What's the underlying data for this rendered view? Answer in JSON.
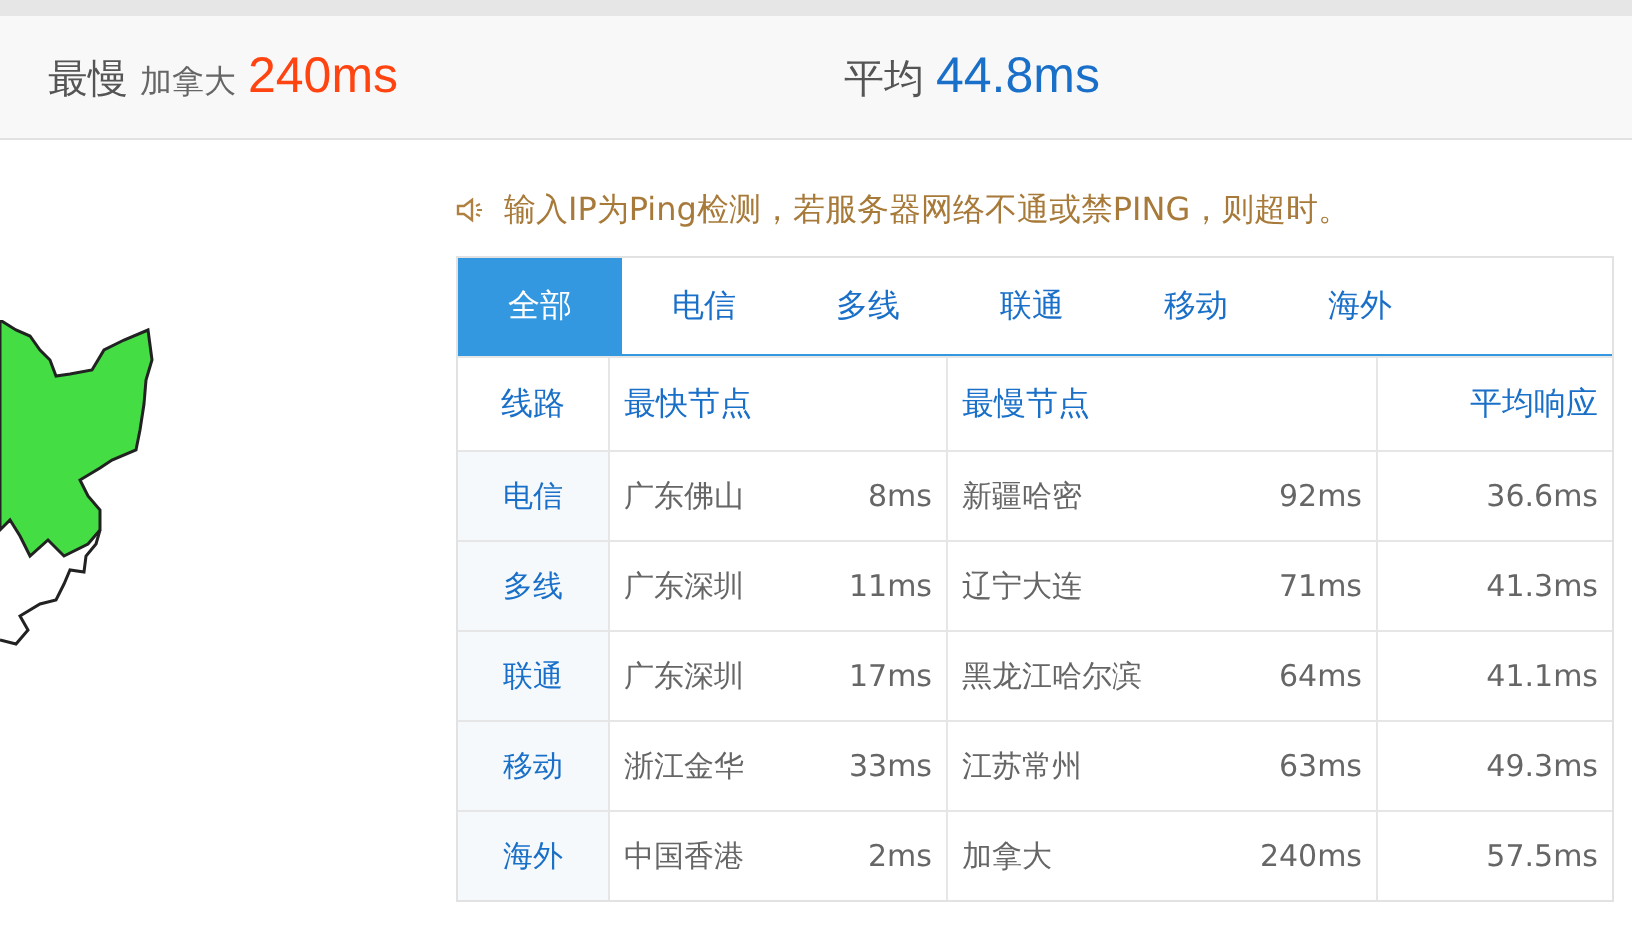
{
  "summary": {
    "slowest": {
      "label": "最慢",
      "location": "加拿大",
      "value": "240ms"
    },
    "average": {
      "label": "平均",
      "value": "44.8ms"
    }
  },
  "notice": "输入IP为Ping检测，若服务器网络不通或禁PING，则超时。",
  "tabs": [
    {
      "label": "全部",
      "selected": true
    },
    {
      "label": "电信",
      "selected": false
    },
    {
      "label": "多线",
      "selected": false
    },
    {
      "label": "联通",
      "selected": false
    },
    {
      "label": "移动",
      "selected": false
    },
    {
      "label": "海外",
      "selected": false
    }
  ],
  "table": {
    "columns": [
      "线路",
      "最快节点",
      "最慢节点",
      "平均响应"
    ],
    "rows": [
      {
        "line": "电信",
        "fastest": "广东佛山",
        "fastest_ms": "8ms",
        "slowest": "新疆哈密",
        "slowest_ms": "92ms",
        "average": "36.6ms"
      },
      {
        "line": "多线",
        "fastest": "广东深圳",
        "fastest_ms": "11ms",
        "slowest": "辽宁大连",
        "slowest_ms": "71ms",
        "average": "41.3ms"
      },
      {
        "line": "联通",
        "fastest": "广东深圳",
        "fastest_ms": "17ms",
        "slowest": "黑龙江哈尔滨",
        "slowest_ms": "64ms",
        "average": "41.1ms"
      },
      {
        "line": "移动",
        "fastest": "浙江金华",
        "fastest_ms": "33ms",
        "slowest": "江苏常州",
        "slowest_ms": "63ms",
        "average": "49.3ms"
      },
      {
        "line": "海外",
        "fastest": "中国香港",
        "fastest_ms": "2ms",
        "slowest": "加拿大",
        "slowest_ms": "240ms",
        "average": "57.5ms"
      }
    ]
  }
}
